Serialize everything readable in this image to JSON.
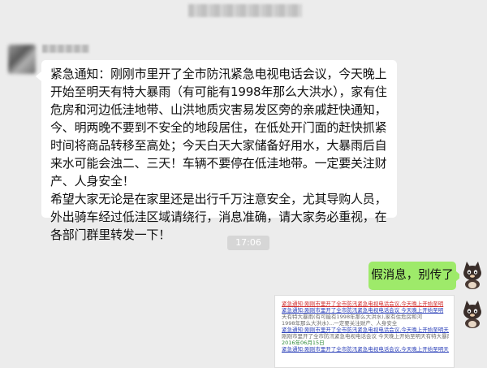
{
  "header": {
    "title_redacted": true
  },
  "incoming": {
    "sender_redacted": true,
    "paragraph1": "紧急通知：刚刚市里开了全市防汛紧急电视电话会议，今天晚上开始至明天有特大暴雨（有可能有1998年那么大洪水），家有住危房和河边低洼地带、山洪地质灾害易发区旁的亲戚赶快通知，今、明两晚不要到不安全的地段居住，在低处开门面的赶快抓紧时间将商品转移至高处；今天白天大家储备好用水，大暴雨后自来水可能会浊二、三天！车辆不要停在低洼地带。一定要关注财产、人身安全！",
    "paragraph2": "希望大家无论是在家里还是出行千万注意安全，尤其导购人员，外出骑车经过低洼区域请绕行，消息准确，请大家务必重视，在各部门群里转发一下！"
  },
  "time_divider": "17:06",
  "outgoing": {
    "reply_text": "假消息，别传了",
    "screenshot": {
      "lines": [
        "紧急通知:刚刚市里开了全市防汛紧急电视电话会议,今天晚上开始至明",
        "紧急通知:刚刚市里开了全市防汛紧急电视电话会议 今天晚上开始至明",
        "天有特大暴雨(有可能有1998年那么大洪水),家有住危房和河",
        "1998年那么大洪水)...一定要关注财产、人身安全",
        "紧急通知:刚刚市里开了全市防汛紧急电视电话会议,今天晚上开始至明天...",
        "刚刚市里开了全市防汛紧急电视电话会议 今天晚上开始至明天有特大暴雨",
        "2016年06月15日",
        "紧急通知:刚刚市里开了全市防汛紧急电视电话会议,今天晚上开始至明天有特大暴雨"
      ]
    }
  },
  "colors": {
    "background": "#ececec",
    "incoming_bubble": "#ffffff",
    "outgoing_bubble": "#9eea6a",
    "time_chip": "#d6d6d6",
    "link_blue": "#2a3fb8"
  },
  "icons": {
    "contact_avatar": "blurred-avatar",
    "self_avatar": "cat-avatar-icon"
  }
}
